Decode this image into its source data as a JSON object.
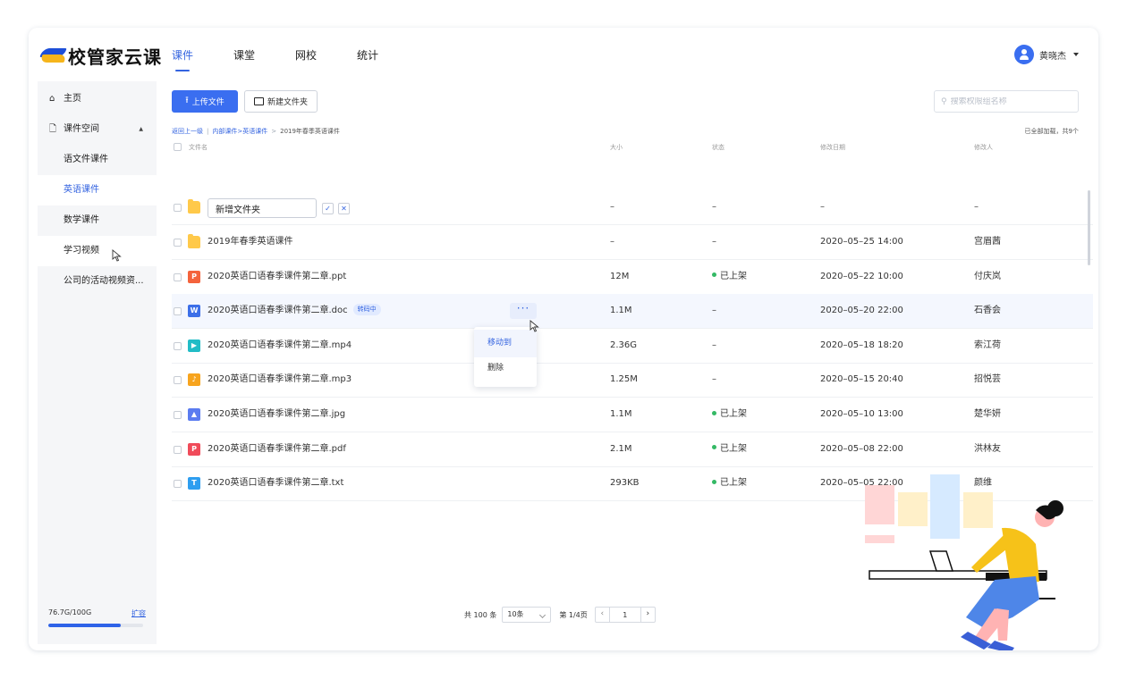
{
  "app": {
    "logo": "校管家云课"
  },
  "header": {
    "tabs": [
      {
        "label": "课件",
        "active": true
      },
      {
        "label": "课堂",
        "active": false
      },
      {
        "label": "网校",
        "active": false
      },
      {
        "label": "统计",
        "active": false
      }
    ],
    "user_name": "黄晓杰"
  },
  "sidebar": {
    "home": "主页",
    "space": "课件空间",
    "items": [
      "语文件课件",
      "英语课件",
      "数学课件",
      "学习视频",
      "公司的活动视频资..."
    ],
    "active_item": "英语课件",
    "storage_text": "76.7G/100G",
    "storage_link": "扩容",
    "storage_fraction": 0.767
  },
  "toolbar": {
    "upload_label": "上传文件",
    "new_folder_label": "新建文件夹",
    "search_placeholder": "搜索权限组名称"
  },
  "breadcrumb": {
    "back": "返回上一级",
    "path1": "内部课件>英语课件",
    "current": "2019年春季英语课件"
  },
  "loaded_text": "已全部加载，共9个",
  "table": {
    "headers": [
      "文件名",
      "大小",
      "状态",
      "修改日期",
      "修改人"
    ],
    "new_folder_value": "新增文件夹",
    "new_folder_cells": [
      "–",
      "–",
      "–",
      "–"
    ],
    "rows": [
      {
        "name": "2019年春季英语课件",
        "type": "folder",
        "size": "–",
        "status": "–",
        "date": "2020–05–25  14:00",
        "user": "宫眉茜"
      },
      {
        "name": "2020英语口语春季课件第二章.ppt",
        "type": "ppt",
        "size": "12M",
        "status": "已上架",
        "date": "2020–05–22  10:00",
        "user": "付庆岚"
      },
      {
        "name": "2020英语口语春季课件第二章.doc",
        "type": "doc",
        "badge": "转码中",
        "size": "1.1M",
        "status": "–",
        "date": "2020–05–20  22:00",
        "user": "石香会"
      },
      {
        "name": "2020英语口语春季课件第二章.mp4",
        "type": "mp4",
        "size": "2.36G",
        "status": "–",
        "date": "2020–05–18  18:20",
        "user": "索江荷"
      },
      {
        "name": "2020英语口语春季课件第二章.mp3",
        "type": "mp3",
        "size": "1.25M",
        "status": "–",
        "date": "2020–05–15  20:40",
        "user": "招悦芸"
      },
      {
        "name": "2020英语口语春季课件第二章.jpg",
        "type": "jpg",
        "size": "1.1M",
        "status": "已上架",
        "date": "2020–05–10  13:00",
        "user": "楚华妍"
      },
      {
        "name": "2020英语口语春季课件第二章.pdf",
        "type": "pdf",
        "size": "2.1M",
        "status": "已上架",
        "date": "2020–05–08  22:00",
        "user": "洪林友"
      },
      {
        "name": "2020英语口语春季课件第二章.txt",
        "type": "txt",
        "size": "293KB",
        "status": "已上架",
        "date": "2020–05–05  22:00",
        "user": "颜维"
      }
    ]
  },
  "context_menu": {
    "items": [
      "移动到",
      "删除"
    ]
  },
  "pagination": {
    "total": "共 100 条",
    "page_size": "10条",
    "page_info": "第 1/4页",
    "current_page": "1"
  },
  "colors": {
    "accent": "#3a6ef0",
    "status_green": "#34b965"
  }
}
